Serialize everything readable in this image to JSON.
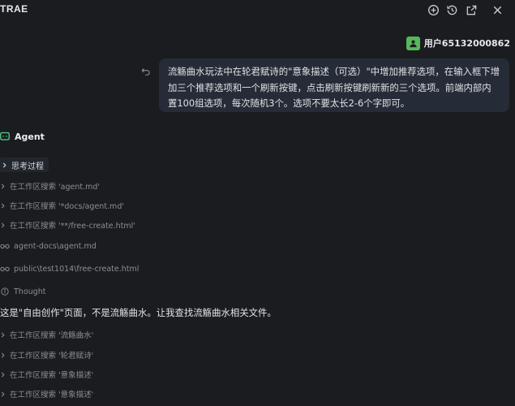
{
  "app": {
    "brand": "TRAE"
  },
  "user": {
    "name": "用户65132000862"
  },
  "message": {
    "text": "流觞曲水玩法中在轮君赋诗的\"意象描述（可选）\"中增加推荐选项，在输入框下增加三个推荐选项和一个刷新按键，点击刷新按键刷新新的三个选项。前端内部内置100组选项，每次随机3个。选项不要太长2-6个字即可。"
  },
  "agent": {
    "name": "Agent",
    "thinking_label": "思考过程",
    "steps_before": [
      {
        "type": "search",
        "label": "在工作区搜索 'agent.md'"
      },
      {
        "type": "search",
        "label": "在工作区搜索 '*docs/agent.md'"
      },
      {
        "type": "search",
        "label": "在工作区搜索 '**/free-create.html'"
      },
      {
        "type": "view",
        "label": "agent-docs\\agent.md"
      },
      {
        "type": "view",
        "label": "public\\test1014\\free-create.html"
      },
      {
        "type": "thought",
        "label": "Thought"
      }
    ],
    "response": "这是\"自由创作\"页面，不是流觞曲水。让我查找流觞曲水相关文件。",
    "steps_after": [
      {
        "type": "search",
        "label": "在工作区搜索 '流觞曲水'"
      },
      {
        "type": "search",
        "label": "在工作区搜索 '轮君赋诗'"
      },
      {
        "type": "search",
        "label": "在工作区搜索 '意象描述'"
      },
      {
        "type": "search",
        "label": "在工作区搜索 '意象描述'"
      }
    ]
  },
  "colors": {
    "accent": "#55b85a",
    "bubble_bg": "#252c37",
    "background": "#1b1c1f"
  }
}
